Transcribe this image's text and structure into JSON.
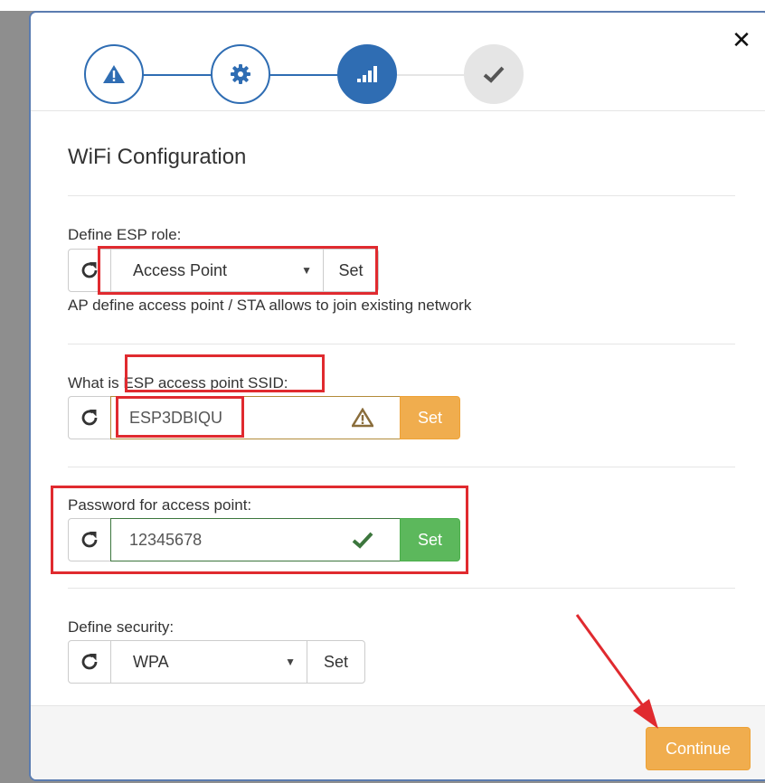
{
  "window": {
    "close_glyph": "✕"
  },
  "wizard": {
    "title": "WiFi Configuration",
    "steps": [
      {
        "icon": "warning-icon",
        "state": "done"
      },
      {
        "icon": "gear-icon",
        "state": "done"
      },
      {
        "icon": "signal-icon",
        "state": "active"
      },
      {
        "icon": "check-icon",
        "state": "todo"
      }
    ]
  },
  "esp_role": {
    "label": "Define ESP role:",
    "selected": "Access Point",
    "set_label": "Set",
    "help": "AP define access point / STA allows to join existing network"
  },
  "ssid": {
    "label": "What is ESP access point SSID:",
    "value": "ESP3DBIQU",
    "status": "warning-icon",
    "set_label": "Set"
  },
  "password": {
    "label": "Password for access point:",
    "value": "12345678",
    "status": "check-icon",
    "set_label": "Set"
  },
  "security": {
    "label": "Define security:",
    "selected": "WPA",
    "set_label": "Set"
  },
  "footer": {
    "continue_label": "Continue"
  },
  "colors": {
    "primary": "#2f6db3",
    "warning": "#f0ad4e",
    "success": "#5cb85c",
    "annotation": "#e02a2f"
  }
}
